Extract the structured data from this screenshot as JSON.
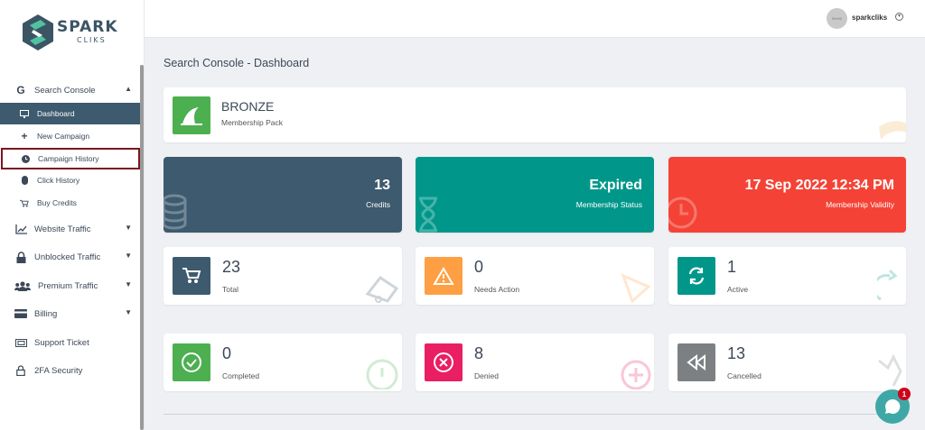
{
  "brand": {
    "name": "SPARK",
    "sub": "CLIKS"
  },
  "header": {
    "avatar_text": "90x90",
    "username": "sparkcliks"
  },
  "page_title": "Search Console - Dashboard",
  "sidebar": {
    "search_console": "Search Console",
    "dashboard": "Dashboard",
    "new_campaign": "New Campaign",
    "campaign_history": "Campaign History",
    "click_history": "Click History",
    "buy_credits": "Buy Credits",
    "website_traffic": "Website Traffic",
    "unblocked_traffic": "Unblocked Traffic",
    "premium_traffic": "Premium Traffic",
    "billing": "Billing",
    "support_ticket": "Support Ticket",
    "twofa": "2FA Security"
  },
  "membership": {
    "tier": "BRONZE",
    "label": "Membership Pack"
  },
  "stats": {
    "credits": {
      "value": "13",
      "label": "Credits"
    },
    "status": {
      "value": "Expired",
      "label": "Membership Status"
    },
    "validity": {
      "value": "17 Sep 2022 12:34 PM",
      "label": "Membership Validity"
    }
  },
  "campaigns": {
    "total": {
      "value": "23",
      "label": "Total"
    },
    "needs_action": {
      "value": "0",
      "label": "Needs Action"
    },
    "active": {
      "value": "1",
      "label": "Active"
    },
    "completed": {
      "value": "0",
      "label": "Completed"
    },
    "denied": {
      "value": "8",
      "label": "Denied"
    },
    "cancelled": {
      "value": "13",
      "label": "Cancelled"
    }
  },
  "chat": {
    "badge": "1"
  },
  "colors": {
    "sidebar_active": "#3d5a6e",
    "credits": "#3d5a6e",
    "status": "#00978a",
    "validity": "#f44336",
    "total": "#3d5a6e",
    "needs_action": "#ff9f43",
    "active": "#00978a",
    "completed": "#4caf50",
    "denied": "#e91e63",
    "cancelled": "#7d8083",
    "chat": "#3fa8a6"
  }
}
